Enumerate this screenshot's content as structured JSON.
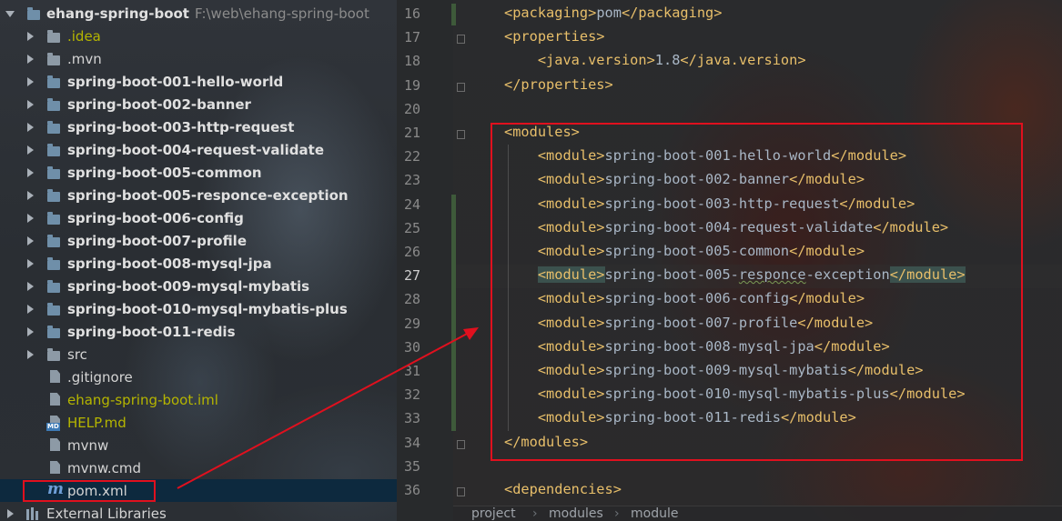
{
  "tree": {
    "root": {
      "name": "ehang-spring-boot",
      "path": "F:\\web\\ehang-spring-boot"
    },
    "items": [
      {
        "label": ".idea",
        "kind": "folder",
        "expandable": true
      },
      {
        "label": ".mvn",
        "kind": "folder",
        "expandable": true
      },
      {
        "label": "spring-boot-001-hello-world",
        "kind": "module",
        "expandable": true
      },
      {
        "label": "spring-boot-002-banner",
        "kind": "module",
        "expandable": true
      },
      {
        "label": "spring-boot-003-http-request",
        "kind": "module",
        "expandable": true
      },
      {
        "label": "spring-boot-004-request-validate",
        "kind": "module",
        "expandable": true
      },
      {
        "label": "spring-boot-005-common",
        "kind": "module",
        "expandable": true
      },
      {
        "label": "spring-boot-005-responce-exception",
        "kind": "module",
        "expandable": true
      },
      {
        "label": "spring-boot-006-config",
        "kind": "module",
        "expandable": true
      },
      {
        "label": "spring-boot-007-profile",
        "kind": "module",
        "expandable": true
      },
      {
        "label": "spring-boot-008-mysql-jpa",
        "kind": "module",
        "expandable": true
      },
      {
        "label": "spring-boot-009-mysql-mybatis",
        "kind": "module",
        "expandable": true
      },
      {
        "label": "spring-boot-010-mysql-mybatis-plus",
        "kind": "module",
        "expandable": true
      },
      {
        "label": "spring-boot-011-redis",
        "kind": "module",
        "expandable": true
      },
      {
        "label": "src",
        "kind": "folder",
        "expandable": true
      },
      {
        "label": ".gitignore",
        "kind": "file"
      },
      {
        "label": "ehang-spring-boot.iml",
        "kind": "iml"
      },
      {
        "label": "HELP.md",
        "kind": "md"
      },
      {
        "label": "mvnw",
        "kind": "file"
      },
      {
        "label": "mvnw.cmd",
        "kind": "file"
      },
      {
        "label": "pom.xml",
        "kind": "maven",
        "selected": true
      }
    ],
    "external_libraries": "External Libraries"
  },
  "editor": {
    "lines": [
      {
        "n": "16",
        "segs": [
          [
            "tag",
            "<packaging>"
          ],
          [
            "txt",
            "pom"
          ],
          [
            "tag",
            "</packaging>"
          ]
        ]
      },
      {
        "n": "17",
        "segs": [
          [
            "tag",
            "<properties>"
          ]
        ]
      },
      {
        "n": "18",
        "segs": [
          [
            "sp",
            "    "
          ],
          [
            "tag",
            "<java.version>"
          ],
          [
            "txt",
            "1.8"
          ],
          [
            "tag",
            "</java.version>"
          ]
        ]
      },
      {
        "n": "19",
        "segs": [
          [
            "tag",
            "</properties>"
          ]
        ]
      },
      {
        "n": "20",
        "segs": []
      },
      {
        "n": "21",
        "segs": [
          [
            "tag",
            "<modules>"
          ]
        ]
      },
      {
        "n": "22",
        "segs": [
          [
            "sp",
            "    "
          ],
          [
            "tag",
            "<module>"
          ],
          [
            "txt",
            "spring-boot-001-hello-world"
          ],
          [
            "tag",
            "</module>"
          ]
        ]
      },
      {
        "n": "23",
        "segs": [
          [
            "sp",
            "    "
          ],
          [
            "tag",
            "<module>"
          ],
          [
            "txt",
            "spring-boot-002-banner"
          ],
          [
            "tag",
            "</module>"
          ]
        ]
      },
      {
        "n": "24",
        "segs": [
          [
            "sp",
            "    "
          ],
          [
            "tag",
            "<module>"
          ],
          [
            "txt",
            "spring-boot-003-http-request"
          ],
          [
            "tag",
            "</module>"
          ]
        ]
      },
      {
        "n": "25",
        "segs": [
          [
            "sp",
            "    "
          ],
          [
            "tag",
            "<module>"
          ],
          [
            "txt",
            "spring-boot-004-request-validate"
          ],
          [
            "tag",
            "</module>"
          ]
        ]
      },
      {
        "n": "26",
        "segs": [
          [
            "sp",
            "    "
          ],
          [
            "tag",
            "<module>"
          ],
          [
            "txt",
            "spring-boot-005-common"
          ],
          [
            "tag",
            "</module>"
          ]
        ]
      },
      {
        "n": "27",
        "segs": [
          [
            "sp",
            "    "
          ],
          [
            "match",
            "<module>"
          ],
          [
            "txt",
            "spring-boot-005-"
          ],
          [
            "wavy",
            "responce"
          ],
          [
            "txt",
            "-exception"
          ],
          [
            "match",
            "</module>"
          ]
        ]
      },
      {
        "n": "28",
        "segs": [
          [
            "sp",
            "    "
          ],
          [
            "tag",
            "<module>"
          ],
          [
            "txt",
            "spring-boot-006-config"
          ],
          [
            "tag",
            "</module>"
          ]
        ]
      },
      {
        "n": "29",
        "segs": [
          [
            "sp",
            "    "
          ],
          [
            "tag",
            "<module>"
          ],
          [
            "txt",
            "spring-boot-007-profile"
          ],
          [
            "tag",
            "</module>"
          ]
        ]
      },
      {
        "n": "30",
        "segs": [
          [
            "sp",
            "    "
          ],
          [
            "tag",
            "<module>"
          ],
          [
            "txt",
            "spring-boot-008-mysql-jpa"
          ],
          [
            "tag",
            "</module>"
          ]
        ]
      },
      {
        "n": "31",
        "segs": [
          [
            "sp",
            "    "
          ],
          [
            "tag",
            "<module>"
          ],
          [
            "txt",
            "spring-boot-009-mysql-mybatis"
          ],
          [
            "tag",
            "</module>"
          ]
        ]
      },
      {
        "n": "32",
        "segs": [
          [
            "sp",
            "    "
          ],
          [
            "tag",
            "<module>"
          ],
          [
            "txt",
            "spring-boot-010-mysql-mybatis-plus"
          ],
          [
            "tag",
            "</module>"
          ]
        ]
      },
      {
        "n": "33",
        "segs": [
          [
            "sp",
            "    "
          ],
          [
            "tag",
            "<module>"
          ],
          [
            "txt",
            "spring-boot-011-redis"
          ],
          [
            "tag",
            "</module>"
          ]
        ]
      },
      {
        "n": "34",
        "segs": [
          [
            "tag",
            "</modules>"
          ]
        ]
      },
      {
        "n": "35",
        "segs": []
      },
      {
        "n": "36",
        "segs": [
          [
            "tag",
            "<dependencies>"
          ]
        ]
      }
    ],
    "current_line": "27",
    "breadcrumb": [
      "project",
      "modules",
      "module"
    ]
  },
  "colors": {
    "annotation_red": "#e0101e",
    "xml_tag": "#e8bf6a",
    "text": "#a9b7c6",
    "selection": "#0d293e"
  }
}
